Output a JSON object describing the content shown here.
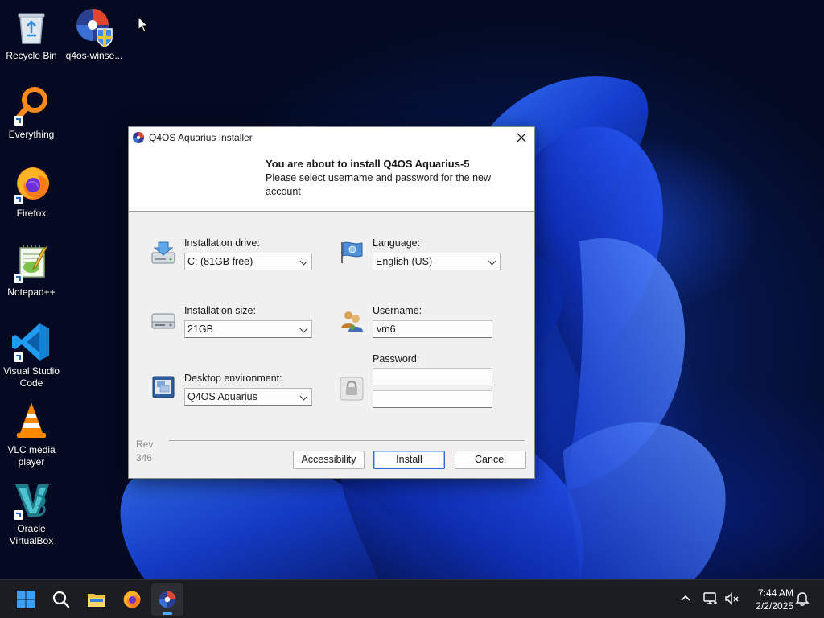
{
  "desktop": {
    "icons": [
      {
        "label": "Recycle Bin",
        "icon": "recycle-bin-icon"
      },
      {
        "label": "q4os-winse...",
        "icon": "q4os-installer-icon"
      },
      {
        "label": "Everything",
        "icon": "everything-search-icon"
      },
      {
        "label": "Firefox",
        "icon": "firefox-icon"
      },
      {
        "label": "Notepad++",
        "icon": "notepad-plus-plus-icon"
      },
      {
        "label": "Visual Studio Code",
        "icon": "vscode-icon"
      },
      {
        "label": "VLC media player",
        "icon": "vlc-icon"
      },
      {
        "label": "Oracle VirtualBox",
        "icon": "virtualbox-icon"
      }
    ]
  },
  "installer": {
    "window_title": "Q4OS Aquarius Installer",
    "header_title": "You are about to install Q4OS Aquarius-5",
    "header_subtitle": "Please select username and password for the new account",
    "installation_drive": {
      "label": "Installation drive:",
      "value": "C: (81GB free)"
    },
    "installation_size": {
      "label": "Installation size:",
      "value": "21GB"
    },
    "desktop_environment": {
      "label": "Desktop environment:",
      "value": "Q4OS Aquarius"
    },
    "language": {
      "label": "Language:",
      "value": "English (US)"
    },
    "username": {
      "label": "Username:",
      "value": "vm6"
    },
    "password": {
      "label": "Password:",
      "value": "",
      "confirm_value": ""
    },
    "rev_label": "Rev",
    "rev_number": "346",
    "buttons": {
      "accessibility": "Accessibility",
      "install": "Install",
      "cancel": "Cancel"
    }
  },
  "taskbar": {
    "pinned": [
      "start",
      "search",
      "file-explorer",
      "firefox",
      "q4os-installer"
    ],
    "active": "q4os-installer",
    "time": "7:44 AM",
    "date": "2/2/2025"
  },
  "colors": {
    "accent": "#2d6bd1",
    "taskbar": "#1b1d22",
    "wallpaper_blue": "#1446e6"
  }
}
